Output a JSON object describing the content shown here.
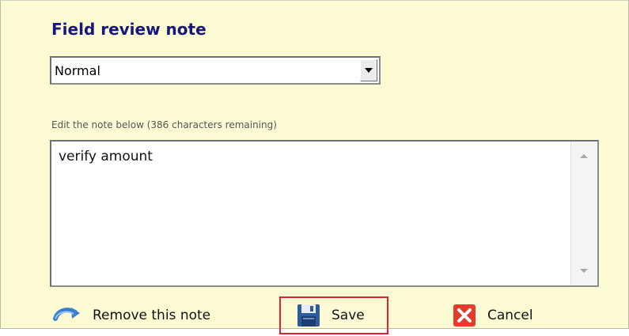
{
  "dialog": {
    "title": "Field review note",
    "priority_select": {
      "selected": "Normal"
    },
    "hint": "Edit the note below (386 characters remaining)",
    "note_text": "verify amount"
  },
  "actions": {
    "remove_label": "Remove this note",
    "save_label": "Save",
    "cancel_label": "Cancel"
  },
  "icons": {
    "remove": "undo-arrow-icon",
    "save": "floppy-disk-icon",
    "cancel": "red-x-icon"
  },
  "colors": {
    "background": "#fdfbd4",
    "title": "#16167e",
    "save_highlight": "#dd2233",
    "cancel_icon": "#e43c2c"
  }
}
